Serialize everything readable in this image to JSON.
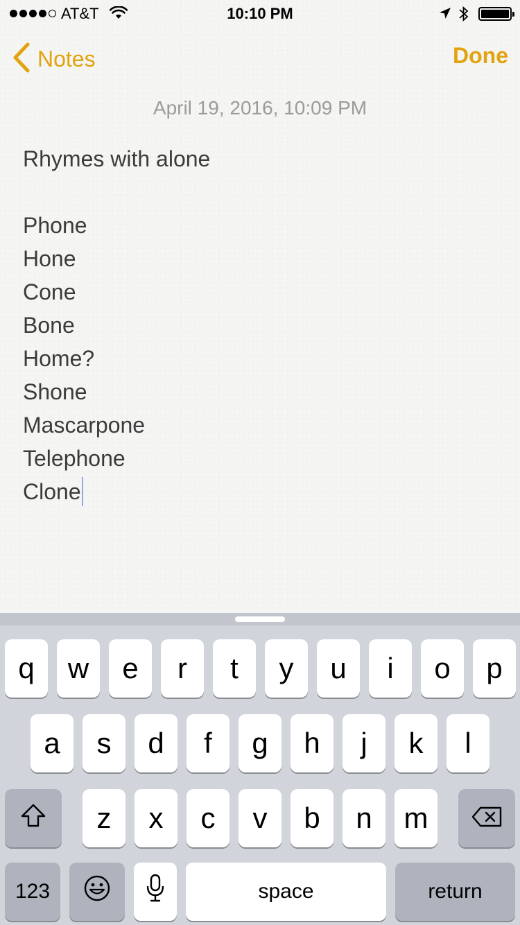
{
  "status_bar": {
    "carrier": "AT&T",
    "time": "10:10 PM",
    "signal_strength": 4,
    "signal_max": 5
  },
  "nav": {
    "back_label": "Notes",
    "done_label": "Done",
    "accent_color": "#e1a30f"
  },
  "note": {
    "date": "April 19, 2016, 10:09 PM",
    "lines": [
      "Rhymes with alone",
      "",
      "Phone",
      "Hone",
      "Cone",
      "Bone",
      "Home?",
      "Shone",
      "Mascarpone",
      "Telephone",
      "Clone"
    ]
  },
  "keyboard": {
    "row1": [
      "q",
      "w",
      "e",
      "r",
      "t",
      "y",
      "u",
      "i",
      "o",
      "p"
    ],
    "row2": [
      "a",
      "s",
      "d",
      "f",
      "g",
      "h",
      "j",
      "k",
      "l"
    ],
    "row3": [
      "z",
      "x",
      "c",
      "v",
      "b",
      "n",
      "m"
    ],
    "numbers_label": "123",
    "space_label": "space",
    "return_label": "return",
    "icons": {
      "shift": "shift-icon",
      "delete": "delete-icon",
      "emoji": "emoji-icon",
      "mic": "microphone-icon"
    }
  }
}
